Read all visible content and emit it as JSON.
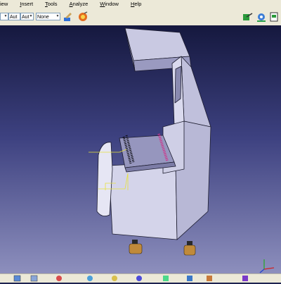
{
  "menubar": {
    "items": [
      {
        "label": "iew",
        "accel": ""
      },
      {
        "label": "Insert",
        "accel": "I"
      },
      {
        "label": "Tools",
        "accel": "T"
      },
      {
        "label": "Analyze",
        "accel": "A"
      },
      {
        "label": "Window",
        "accel": "W"
      },
      {
        "label": "Help",
        "accel": "H"
      }
    ]
  },
  "toolbar": {
    "combo_1": "",
    "combo_2": "Aut",
    "combo_3": "Aut",
    "combo_4": "None",
    "icons": [
      "paint-brush-icon",
      "eraser-icon",
      "analysis-icon",
      "settings-icon",
      "document-icon"
    ]
  },
  "viewport": {
    "model_icons": [
      "machine-cabinet-model",
      "compass-axis-icon"
    ]
  },
  "bottom_toolbar": {
    "icons": [
      "fit-all-icon",
      "pan-icon",
      "rotate-icon",
      "zoom-in-icon",
      "zoom-out-icon",
      "normal-view-icon",
      "iso-view-icon",
      "shading-icon",
      "hide-show-icon",
      "swap-icon"
    ]
  },
  "colors": {
    "ui_bg": "#ece9d8",
    "viewport_top": "#15183e",
    "viewport_bottom": "#8d8fbd",
    "model_body": "#c9c9e2",
    "model_edge": "#1b1b2e",
    "accent_magenta": "#d0338a",
    "accent_yellow": "#e8e23c"
  }
}
